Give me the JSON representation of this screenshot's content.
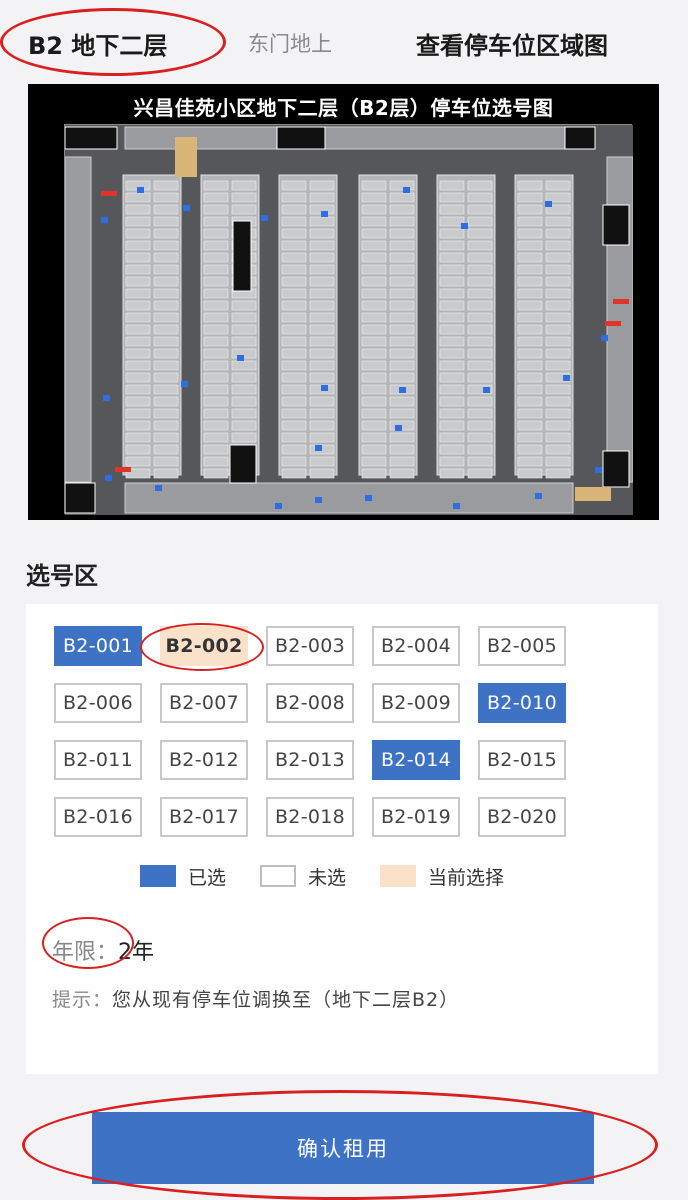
{
  "tabs": {
    "active": "B2 地下二层",
    "other": "东门地上"
  },
  "view_area_link": "查看停车位区域图",
  "map": {
    "title": "兴昌佳苑小区地下二层（B2层）停车位选号图"
  },
  "select_section": {
    "title": "选号区",
    "spots": [
      {
        "label": "B2-001",
        "status": "taken"
      },
      {
        "label": "B2-002",
        "status": "current"
      },
      {
        "label": "B2-003",
        "status": "free"
      },
      {
        "label": "B2-004",
        "status": "free"
      },
      {
        "label": "B2-005",
        "status": "free"
      },
      {
        "label": "B2-006",
        "status": "free"
      },
      {
        "label": "B2-007",
        "status": "free"
      },
      {
        "label": "B2-008",
        "status": "free"
      },
      {
        "label": "B2-009",
        "status": "free"
      },
      {
        "label": "B2-010",
        "status": "taken"
      },
      {
        "label": "B2-011",
        "status": "free"
      },
      {
        "label": "B2-012",
        "status": "free"
      },
      {
        "label": "B2-013",
        "status": "free"
      },
      {
        "label": "B2-014",
        "status": "taken"
      },
      {
        "label": "B2-015",
        "status": "free"
      },
      {
        "label": "B2-016",
        "status": "free"
      },
      {
        "label": "B2-017",
        "status": "free"
      },
      {
        "label": "B2-018",
        "status": "free"
      },
      {
        "label": "B2-019",
        "status": "free"
      },
      {
        "label": "B2-020",
        "status": "free"
      }
    ],
    "legend": {
      "taken": "已选",
      "free": "未选",
      "current": "当前选择"
    },
    "term": {
      "label": "年限：",
      "value": "2年"
    },
    "hint": {
      "label": "提示：",
      "text": "您从现有停车位调换至（地下二层B2）"
    }
  },
  "confirm_label": "确认租用",
  "colors": {
    "taken": "#3d72c4",
    "current": "#f9e1ca",
    "annotation": "#d8211f"
  }
}
